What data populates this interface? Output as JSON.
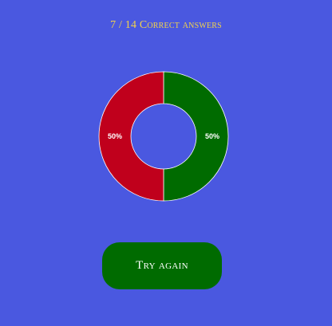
{
  "score": {
    "title": "7 / 14 Correct answers"
  },
  "actions": {
    "try_again_label": "Try again"
  },
  "colors": {
    "background": "#4a58e0",
    "title": "#f2d24a",
    "correct": "#006b00",
    "incorrect": "#c0001c",
    "button": "#006b00"
  },
  "chart_data": {
    "type": "pie",
    "title": "",
    "slices": [
      {
        "value": 50,
        "label": "50%",
        "color": "#006b00"
      },
      {
        "value": 50,
        "label": "50%",
        "color": "#c0001c"
      }
    ]
  }
}
